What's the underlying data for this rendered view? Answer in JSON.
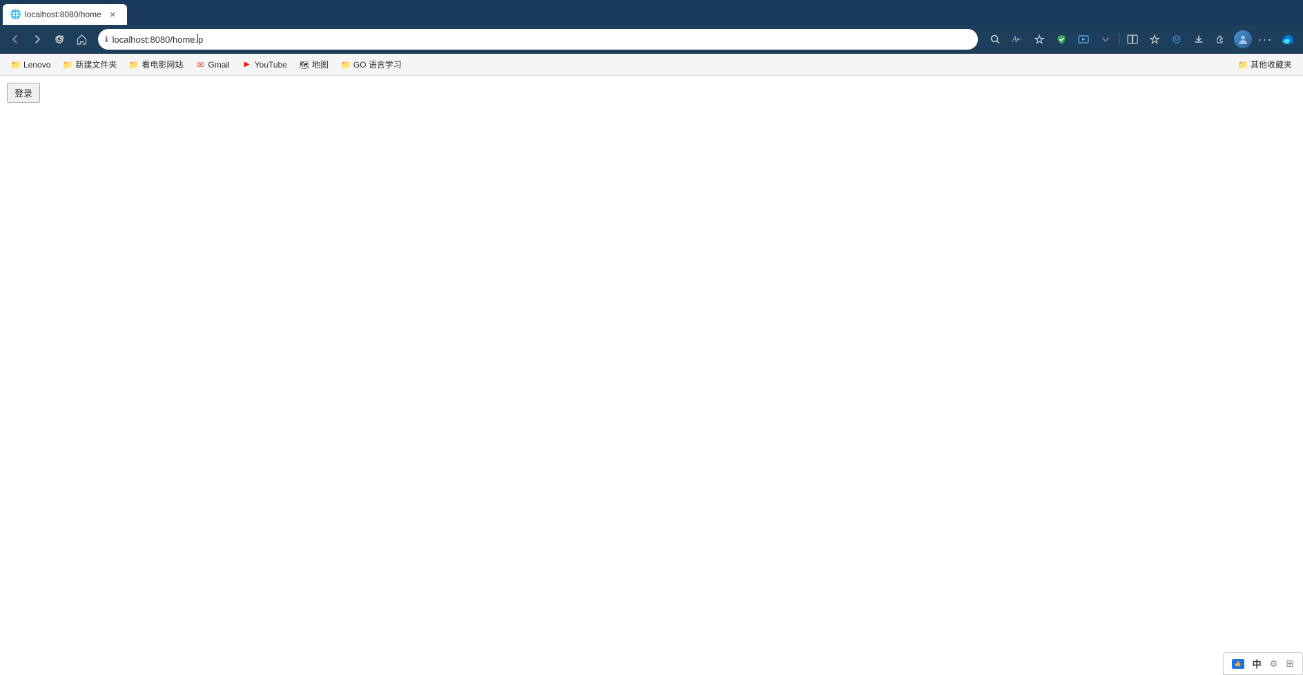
{
  "browser": {
    "tab": {
      "title": "localhost:8080/home",
      "favicon": "🌐"
    },
    "nav": {
      "back_tooltip": "后退",
      "forward_tooltip": "前进",
      "refresh_tooltip": "刷新",
      "home_tooltip": "主页",
      "address": "localhost:8080/home.",
      "address_suffix": "p"
    },
    "toolbar_icons": [
      {
        "name": "search-icon",
        "symbol": "🔍"
      },
      {
        "name": "read-aloud-icon",
        "symbol": "A"
      },
      {
        "name": "favorites-icon",
        "symbol": "☆"
      },
      {
        "name": "shield-icon",
        "symbol": "🛡"
      },
      {
        "name": "video-icon",
        "symbol": "▶"
      },
      {
        "name": "videodown-icon",
        "symbol": "▼"
      },
      {
        "name": "refresh-icon",
        "symbol": "↺"
      },
      {
        "name": "split-icon",
        "symbol": "⊟"
      },
      {
        "name": "star-icon",
        "symbol": "☆"
      },
      {
        "name": "copilot-icon",
        "symbol": "✦"
      },
      {
        "name": "download-icon",
        "symbol": "⬇"
      },
      {
        "name": "extensions-icon",
        "symbol": "🧩"
      },
      {
        "name": "profile-avatar",
        "symbol": ""
      },
      {
        "name": "more-icon",
        "symbol": "···"
      },
      {
        "name": "edge-icon",
        "symbol": "🌐"
      }
    ]
  },
  "bookmarks": {
    "items": [
      {
        "id": "lenovo",
        "label": "Lenovo",
        "icon": "📁",
        "type": "folder"
      },
      {
        "id": "new-folder",
        "label": "新建文件夹",
        "icon": "📁",
        "type": "folder"
      },
      {
        "id": "movie-site",
        "label": "看电影网站",
        "icon": "📁",
        "type": "folder"
      },
      {
        "id": "gmail",
        "label": "Gmail",
        "icon": "✉",
        "type": "link",
        "color": "#EA4335"
      },
      {
        "id": "youtube",
        "label": "YouTube",
        "icon": "▶",
        "type": "link",
        "color": "#FF0000"
      },
      {
        "id": "maps",
        "label": "地图",
        "icon": "🗺",
        "type": "link"
      },
      {
        "id": "go-lang",
        "label": "GO 语言学习",
        "icon": "📁",
        "type": "folder"
      }
    ],
    "others_label": "其他收藏夹"
  },
  "page": {
    "login_button_label": "登录"
  },
  "status_bar": {
    "thumb_label": "👍",
    "lang_label": "中",
    "settings_label": "⚙",
    "grid_label": "⊞"
  }
}
